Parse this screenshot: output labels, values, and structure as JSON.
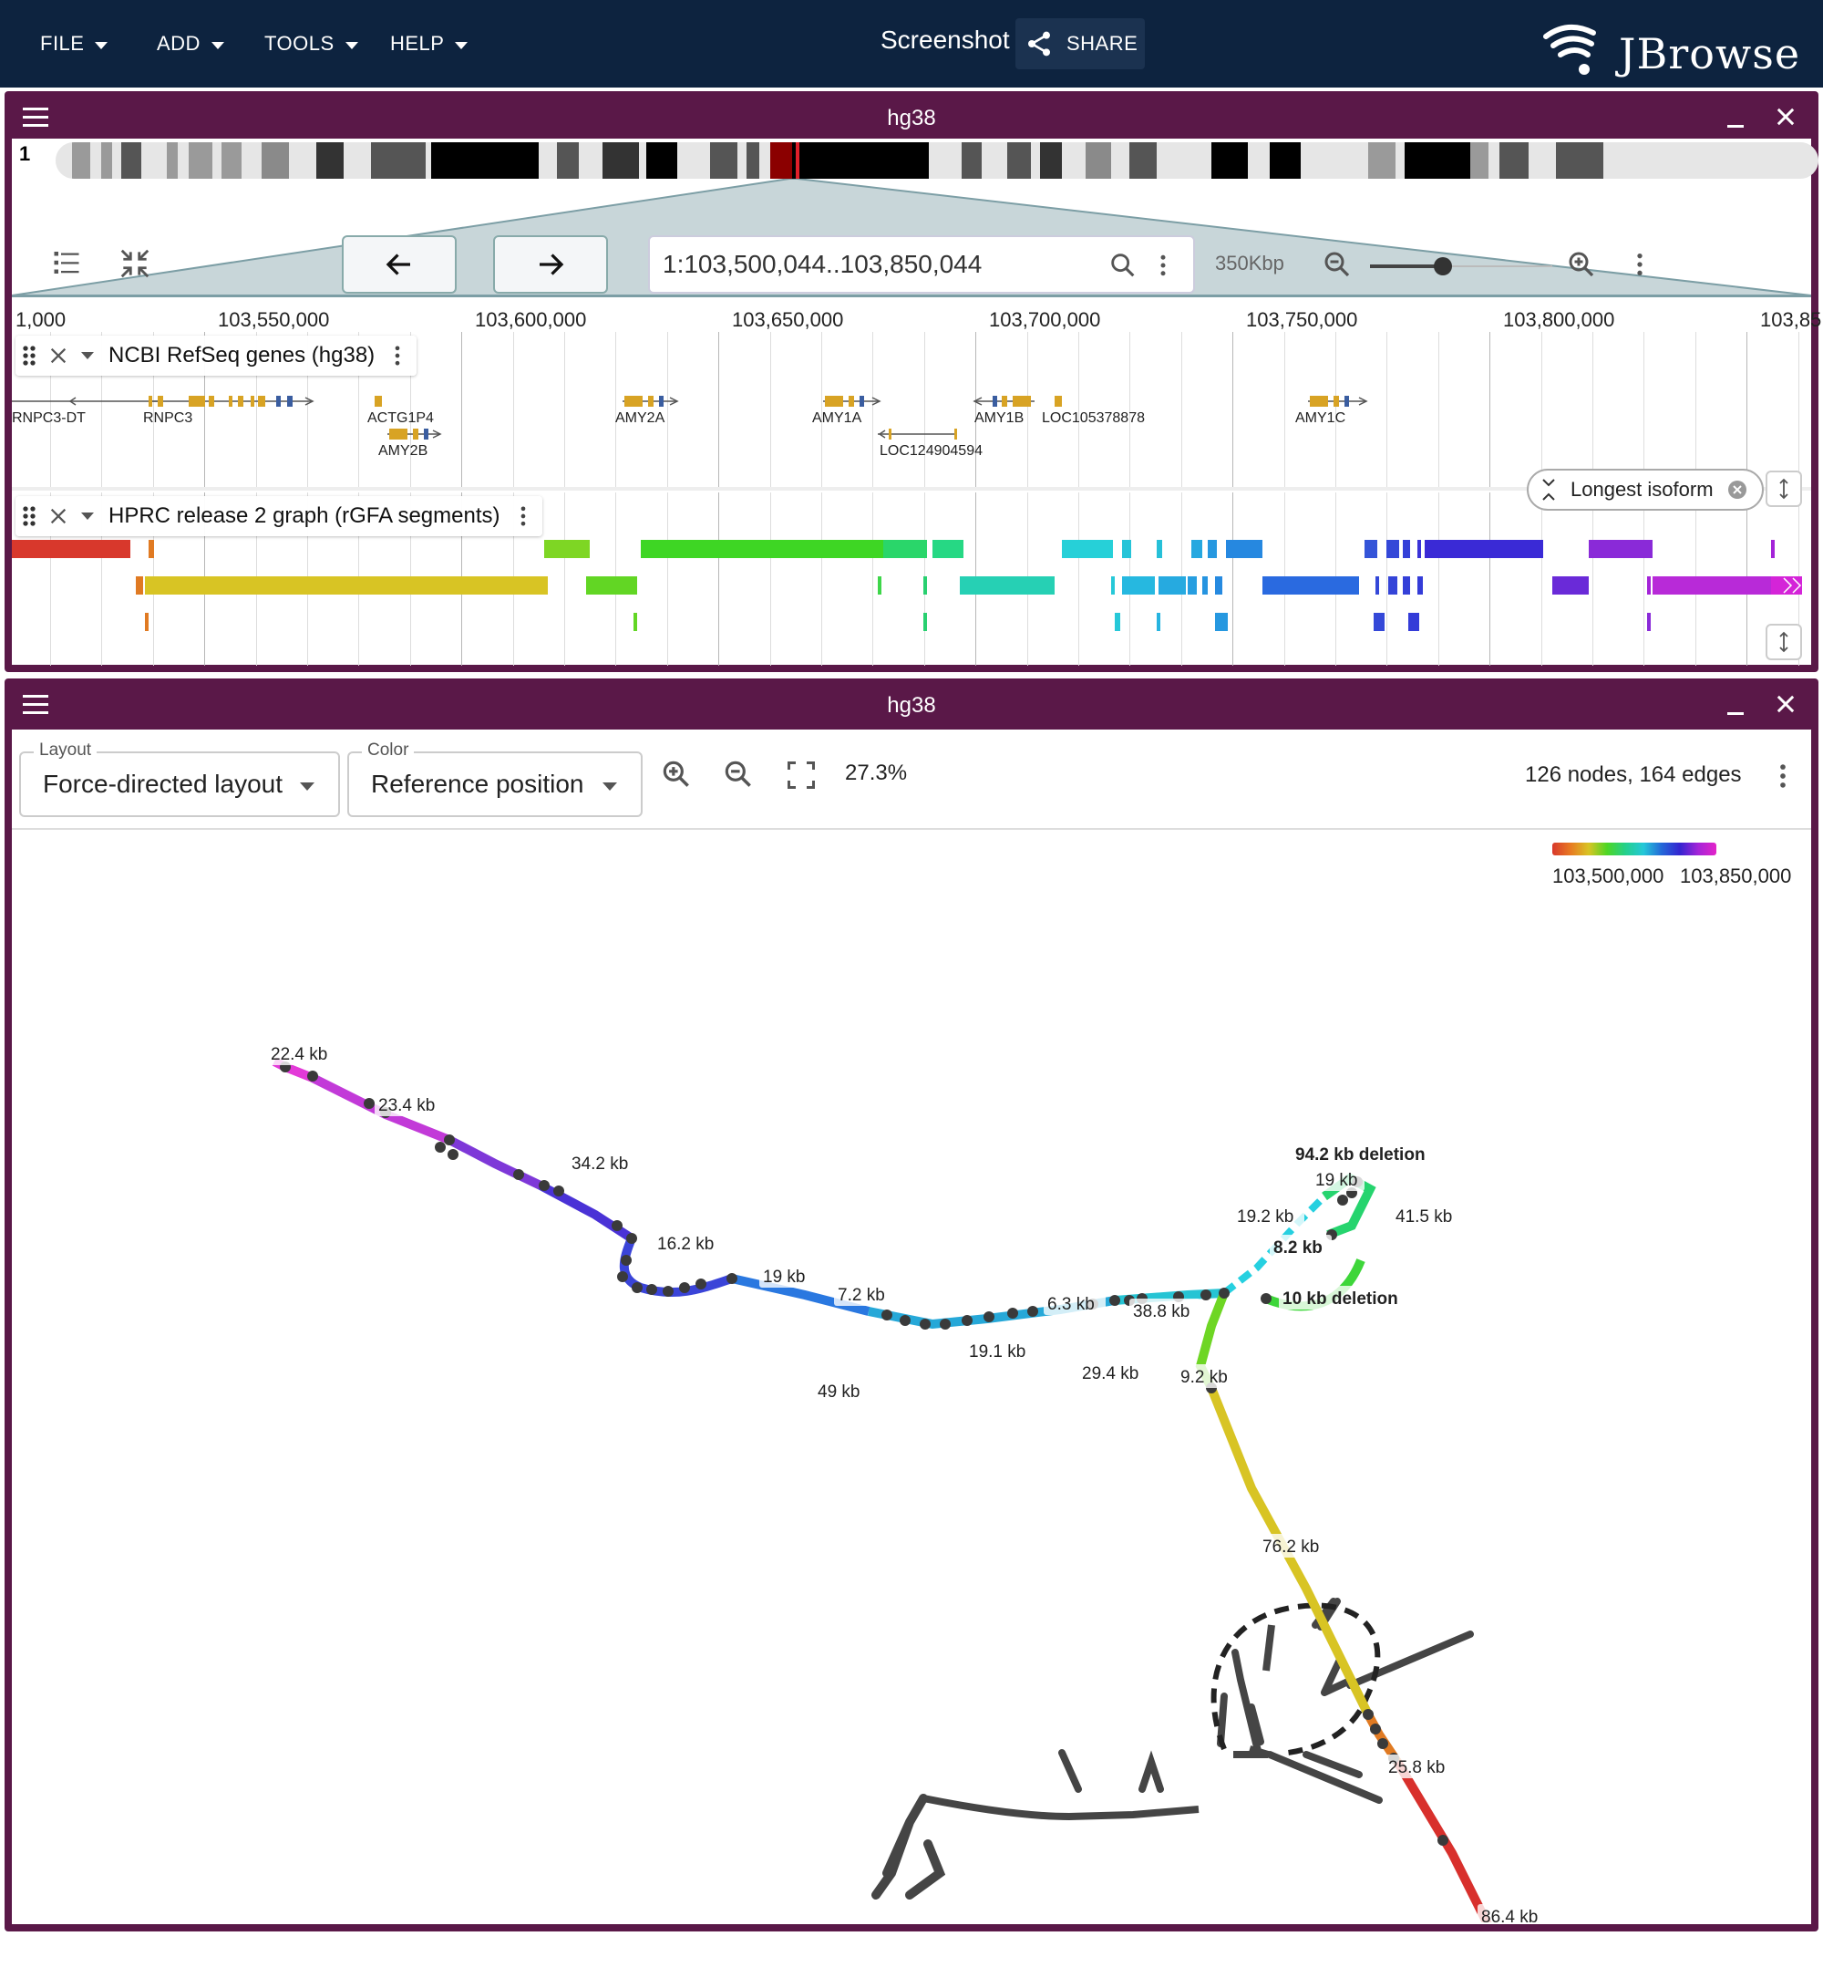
{
  "menu": {
    "file": "FILE",
    "add": "ADD",
    "tools": "TOOLS",
    "help": "HELP"
  },
  "header": {
    "screenshot_title": "Screenshot",
    "share_label": "SHARE",
    "logo_text": "JBrowse"
  },
  "linear_view": {
    "title": "hg38",
    "chromosome": "1",
    "location": "1:103,500,044..103,850,044",
    "scale": "350Kbp",
    "zoom_fraction": 0.4,
    "ruler_ticks": [
      "1,000",
      "103,550,000",
      "103,600,000",
      "103,650,000",
      "103,700,000",
      "103,750,000",
      "103,800,000",
      "103,85"
    ],
    "tracks": {
      "genes": {
        "name": "NCBI RefSeq genes (hg38)",
        "genes": [
          "RNPC3-DT",
          "RNPC3",
          "ACTG1P4",
          "AMY2B",
          "AMY2A",
          "AMY1A",
          "LOC124904594",
          "AMY1B",
          "LOC105378878",
          "AMY1C"
        ],
        "chip_label": "Longest isoform"
      },
      "graph": {
        "name": "HPRC release 2 graph (rGFA segments)"
      }
    }
  },
  "graph_view": {
    "title": "hg38",
    "layout_label": "Layout",
    "layout_value": "Force-directed layout",
    "color_label": "Color",
    "color_value": "Reference position",
    "zoom": "27.3%",
    "stats": "126 nodes, 164 edges",
    "legend_min": "103,500,000",
    "legend_max": "103,850,000",
    "edge_labels": [
      "22.4 kb",
      "23.4 kb",
      "34.2 kb",
      "16.2 kb",
      "19 kb",
      "7.2 kb",
      "49 kb",
      "19.1 kb",
      "6.3 kb",
      "29.4 kb",
      "38.8 kb",
      "9.2 kb",
      "94.2 kb deletion",
      "19 kb",
      "19.2 kb",
      "41.5 kb",
      "8.2 kb",
      "10 kb deletion",
      "76.2 kb",
      "25.8 kb",
      "86.4 kb"
    ]
  }
}
